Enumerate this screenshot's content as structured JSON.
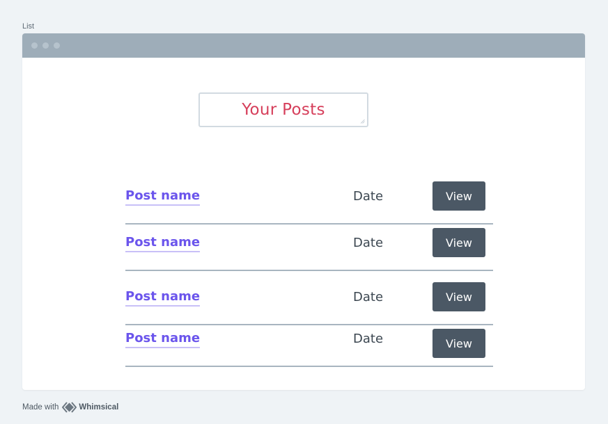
{
  "frame": {
    "label": "List"
  },
  "heading": {
    "text": "Your Posts"
  },
  "posts": [
    {
      "name": "Post name",
      "date": "Date",
      "action": "View"
    },
    {
      "name": "Post name",
      "date": "Date",
      "action": "View"
    },
    {
      "name": "Post name",
      "date": "Date",
      "action": "View"
    },
    {
      "name": "Post name",
      "date": "Date",
      "action": "View"
    }
  ],
  "footer": {
    "made_with": "Made with",
    "brand": "Whimsical",
    "logo_icon": "whimsical-logo-icon"
  },
  "colors": {
    "page_background": "#eff3f6",
    "titlebar": "#9eadb9",
    "heading_text": "#d63f5b",
    "link": "#6b55ec",
    "button": "#4b5865",
    "divider": "#a8b5c0"
  }
}
